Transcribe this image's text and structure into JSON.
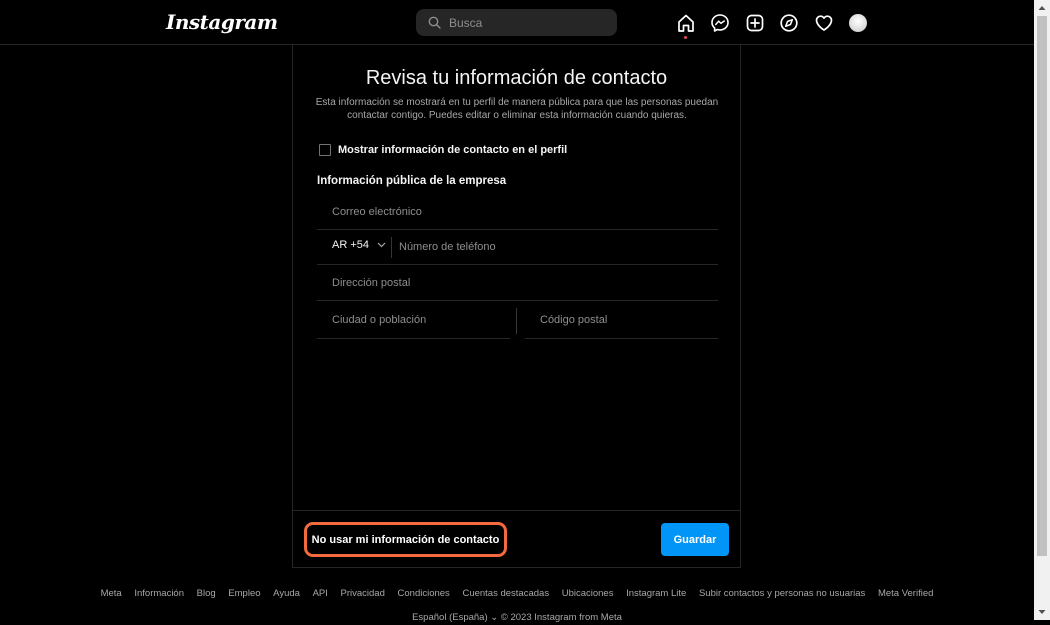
{
  "nav": {
    "logo": "Instagram",
    "search_placeholder": "Busca",
    "icons": [
      "home-icon",
      "messenger-icon",
      "create-icon",
      "explore-icon",
      "heart-icon",
      "avatar"
    ]
  },
  "modal": {
    "title": "Revisa tu información de contacto",
    "description": "Esta información se mostrará en tu perfil de manera pública para que las personas puedan contactar contigo. Puedes editar o eliminar esta información cuando quieras.",
    "checkbox_label": "Mostrar información de contacto en el perfil",
    "checkbox_checked": false,
    "section_title": "Información pública de la empresa",
    "email_placeholder": "Correo electrónico",
    "country_code": "AR +54",
    "phone_placeholder": "Número de teléfono",
    "address_placeholder": "Dirección postal",
    "city_placeholder": "Ciudad o población",
    "zip_placeholder": "Código postal",
    "no_use_label": "No usar mi información de contacto",
    "save_label": "Guardar"
  },
  "colors": {
    "accent": "#0095f6",
    "highlight": "#f36a3f",
    "background": "#000000"
  },
  "footer": {
    "links": [
      "Meta",
      "Información",
      "Blog",
      "Empleo",
      "Ayuda",
      "API",
      "Privacidad",
      "Condiciones",
      "Cuentas destacadas",
      "Ubicaciones",
      "Instagram Lite",
      "Subir contactos y personas no usuarias",
      "Meta Verified"
    ],
    "bottom": "Español (España) ⌄    © 2023 Instagram from Meta"
  }
}
